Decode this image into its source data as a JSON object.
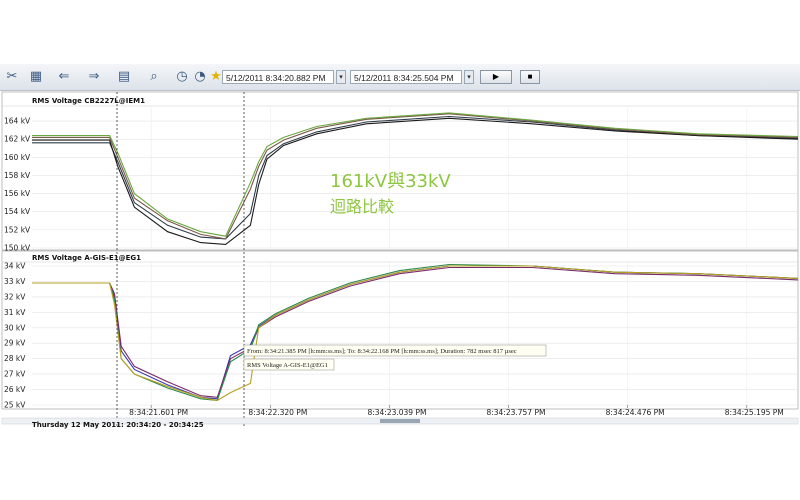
{
  "toolbar": {
    "icons": [
      "tools-icon",
      "channel-add-icon",
      "back-icon",
      "forward-icon",
      "view-icon",
      "zoom-icon",
      "clock-icon",
      "history-icon",
      "favorite-icon"
    ],
    "from_time": "5/12/2011 8:34:20.882 PM",
    "to_time": "5/12/2011 8:34:25.504 PM"
  },
  "overlay": {
    "line1": "161kV與33kV",
    "line2": "迴路比較",
    "color": "#8dc63f"
  },
  "annotation": {
    "measure": "From: 8:34:21.385 PM [h:mm:ss.ms]; To: 8:34:22.168 PM [h:mm:ss.ms]; Duration: 782 msec 817 µsec",
    "channel": "RMS Voltage A-GIS-E1@EG1"
  },
  "footer": "Thursday 12 May 2011: 20:34:20 - 20:34:25",
  "chart_data": [
    {
      "type": "line",
      "title": "RMS Voltage CB2227L@IEM1",
      "yunit": "kV",
      "ylim": [
        150,
        165
      ],
      "yticks": [
        "150 kV",
        "152 kV",
        "154 kV",
        "156 kV",
        "158 kV",
        "160 kV",
        "162 kV",
        "164 kV"
      ],
      "x": [
        20.882,
        21.35,
        21.4,
        21.5,
        21.7,
        21.9,
        22.05,
        22.2,
        22.25,
        22.3,
        22.4,
        22.6,
        22.9,
        23.4,
        23.9,
        24.4,
        24.9,
        25.504
      ],
      "series": [
        {
          "color": "#2f3b4a",
          "values": [
            161.6,
            161.6,
            159.5,
            155.0,
            152.5,
            151.2,
            151.0,
            153.8,
            158.0,
            160.2,
            161.5,
            162.8,
            163.9,
            164.5,
            163.9,
            163.0,
            162.4,
            162.1
          ]
        },
        {
          "color": "#1a1a1a",
          "values": [
            161.9,
            161.9,
            159.0,
            154.5,
            151.8,
            150.6,
            150.4,
            152.5,
            157.0,
            159.8,
            161.3,
            162.6,
            163.7,
            164.3,
            163.7,
            162.9,
            162.4,
            162.0
          ]
        },
        {
          "color": "#7a5a4a",
          "values": [
            162.2,
            162.2,
            160.0,
            155.5,
            153.0,
            151.5,
            151.0,
            156.5,
            159.0,
            160.8,
            161.9,
            163.2,
            164.2,
            164.8,
            164.0,
            163.1,
            162.5,
            162.2
          ]
        },
        {
          "color": "#6aa840",
          "values": [
            162.4,
            162.4,
            160.5,
            156.0,
            153.2,
            151.8,
            151.3,
            157.2,
            159.5,
            161.2,
            162.2,
            163.4,
            164.3,
            164.9,
            164.1,
            163.2,
            162.6,
            162.3
          ]
        }
      ]
    },
    {
      "type": "line",
      "title": "RMS Voltage A-GIS-E1@EG1",
      "yunit": "kV",
      "ylim": [
        25,
        34
      ],
      "yticks": [
        "25 kV",
        "26 kV",
        "27 kV",
        "28 kV",
        "29 kV",
        "30 kV",
        "31 kV",
        "32 kV",
        "33 kV",
        "34 kV"
      ],
      "xticks": [
        "8:34:21.601 PM",
        "8:34:22.320 PM",
        "8:34:23.039 PM",
        "8:34:23.757 PM",
        "8:34:24.476 PM",
        "8:34:25.195 PM"
      ],
      "x": [
        20.882,
        21.35,
        21.38,
        21.42,
        21.5,
        21.7,
        21.9,
        22.0,
        22.08,
        22.2,
        22.25,
        22.35,
        22.55,
        22.8,
        23.1,
        23.4,
        23.9,
        24.4,
        24.9,
        25.504
      ],
      "series": [
        {
          "color": "#3a3ab0",
          "values": [
            32.9,
            32.9,
            32.0,
            28.5,
            27.3,
            26.3,
            25.5,
            25.4,
            28.2,
            28.9,
            30.1,
            30.8,
            31.8,
            32.8,
            33.6,
            34.0,
            34.0,
            33.6,
            33.5,
            33.2
          ]
        },
        {
          "color": "#7a2a6a",
          "values": [
            32.9,
            32.9,
            32.2,
            28.8,
            27.5,
            26.5,
            25.6,
            25.5,
            28.0,
            28.7,
            30.0,
            30.7,
            31.7,
            32.7,
            33.5,
            33.9,
            33.9,
            33.5,
            33.4,
            33.1
          ]
        },
        {
          "color": "#2e8a4a",
          "values": [
            32.9,
            32.9,
            31.8,
            28.0,
            27.0,
            26.1,
            25.4,
            25.3,
            27.8,
            28.6,
            30.2,
            30.9,
            31.9,
            32.9,
            33.7,
            34.1,
            34.0,
            33.6,
            33.5,
            33.2
          ]
        },
        {
          "color": "#b8a020",
          "values": [
            32.9,
            32.9,
            31.5,
            28.0,
            27.0,
            26.2,
            25.5,
            25.3,
            25.8,
            26.4,
            30.0,
            30.8,
            31.8,
            32.8,
            33.6,
            34.0,
            34.0,
            33.6,
            33.5,
            33.2
          ]
        }
      ]
    }
  ]
}
